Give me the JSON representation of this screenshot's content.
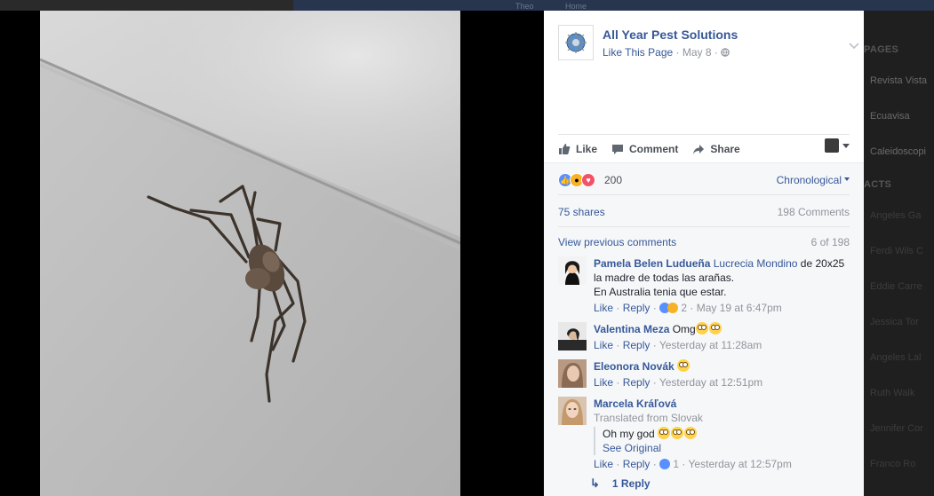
{
  "topbar": {
    "nav1": "Theo",
    "nav2": "Home"
  },
  "post": {
    "page_name": "All Year Pest Solutions",
    "like_page": "Like This Page",
    "date": "May 8",
    "sep": "·",
    "icons": {
      "audience": "globe-icon",
      "options": "chevron-down-icon"
    }
  },
  "actions": {
    "like": "Like",
    "comment": "Comment",
    "share": "Share"
  },
  "reactions": {
    "count": "200",
    "types": [
      "like",
      "wow",
      "love"
    ],
    "sort": "Chronological"
  },
  "stats": {
    "shares": "75 shares",
    "comments": "198 Comments"
  },
  "pagination": {
    "view_previous": "View previous comments",
    "counter": "6 of 198"
  },
  "comments": [
    {
      "name": "Pamela Belen Ludueña",
      "tag": "Lucrecia Mondino",
      "text_after_tag": " de 20x25 la madre de todas las arañas.",
      "line2": "En Australia tenia que estar.",
      "like": "Like",
      "reply": "Reply",
      "reactions": "2",
      "time": "May 19 at 6:47pm"
    },
    {
      "name": "Valentina Meza",
      "text": "Omg",
      "like": "Like",
      "reply": "Reply",
      "time": "Yesterday at 11:28am"
    },
    {
      "name": "Eleonora Novák",
      "text": "",
      "like": "Like",
      "reply": "Reply",
      "time": "Yesterday at 12:51pm"
    },
    {
      "name": "Marcela Kráľová",
      "translated": "Translated from Slovak",
      "text": "Oh my god",
      "see_original": "See Original",
      "like": "Like",
      "reply": "Reply",
      "reactions": "1",
      "time": "Yesterday at 12:57pm"
    }
  ],
  "replies_link": "1 Reply",
  "sidebar": {
    "header1": "PAGES",
    "items": [
      "Revista Vista",
      "Ecuavisa",
      "Caleidoscopi"
    ],
    "header2": "ACTS",
    "faint": [
      "Angeles Ga",
      "Ferdi Wils C",
      "Eddie Carre",
      "Jessica Tor",
      "Angeles Lal",
      "Ruth Walk",
      "Jennifer Cor",
      "Franco Ro"
    ]
  }
}
